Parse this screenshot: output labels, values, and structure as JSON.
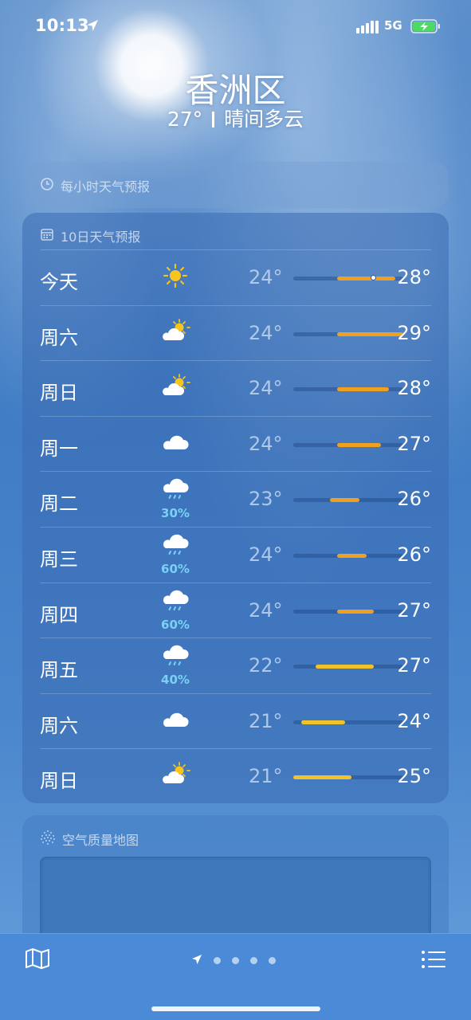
{
  "status_bar": {
    "time": "10:13",
    "network": "5G"
  },
  "header": {
    "city": "香洲区",
    "temp": "27°",
    "condition": "晴间多云"
  },
  "hourly": {
    "title": "每小时天气预报"
  },
  "ten_day": {
    "title": "10日天气预报",
    "days": [
      {
        "day": "今天",
        "icon": "sun-icon",
        "precip": "",
        "low": "24°",
        "high": "28°",
        "bar_start": 0.4,
        "bar_end": 0.93,
        "current": 0.73
      },
      {
        "day": "周六",
        "icon": "partly-cloudy-icon",
        "precip": "",
        "low": "24°",
        "high": "29°",
        "bar_start": 0.4,
        "bar_end": 1.0
      },
      {
        "day": "周日",
        "icon": "partly-cloudy-icon",
        "precip": "",
        "low": "24°",
        "high": "28°",
        "bar_start": 0.4,
        "bar_end": 0.87
      },
      {
        "day": "周一",
        "icon": "cloud-icon",
        "precip": "",
        "low": "24°",
        "high": "27°",
        "bar_start": 0.4,
        "bar_end": 0.8
      },
      {
        "day": "周二",
        "icon": "rain-icon",
        "precip": "30%",
        "low": "23°",
        "high": "26°",
        "bar_start": 0.33,
        "bar_end": 0.6
      },
      {
        "day": "周三",
        "icon": "rain-icon",
        "precip": "60%",
        "low": "24°",
        "high": "26°",
        "bar_start": 0.4,
        "bar_end": 0.67
      },
      {
        "day": "周四",
        "icon": "rain-icon",
        "precip": "60%",
        "low": "24°",
        "high": "27°",
        "bar_start": 0.4,
        "bar_end": 0.73
      },
      {
        "day": "周五",
        "icon": "rain-icon",
        "precip": "40%",
        "low": "22°",
        "high": "27°",
        "bar_start": 0.2,
        "bar_end": 0.73
      },
      {
        "day": "周六",
        "icon": "cloud-icon",
        "precip": "",
        "low": "21°",
        "high": "24°",
        "bar_start": 0.07,
        "bar_end": 0.47
      },
      {
        "day": "周日",
        "icon": "partly-cloudy-icon",
        "precip": "",
        "low": "21°",
        "high": "25°",
        "bar_start": 0.0,
        "bar_end": 0.53
      }
    ]
  },
  "air_quality": {
    "title": "空气质量地图"
  },
  "colors": {
    "bar_warm": "#f0a020",
    "bar_mild": "#f2c22a",
    "precip": "#7ad0f5"
  }
}
